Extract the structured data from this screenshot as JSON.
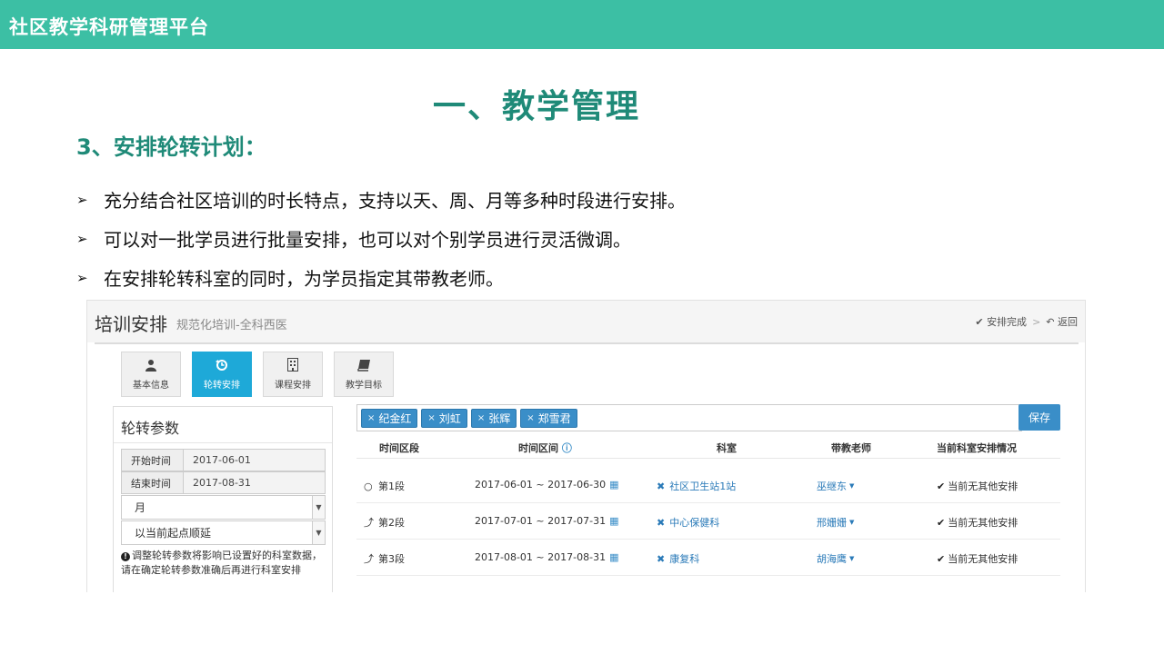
{
  "topbar": {
    "title": "社区教学科研管理平台"
  },
  "slide": {
    "title": "一、教学管理",
    "section": "3、安排轮转计划：",
    "bullets": [
      "充分结合社区培训的时长特点，支持以天、周、月等多种时段进行安排。",
      "可以对一批学员进行批量安排，也可以对个别学员进行灵活微调。",
      "在安排轮转科室的同时，为学员指定其带教老师。"
    ]
  },
  "app": {
    "title": "培训安排",
    "subtitle": "规范化培训-全科西医",
    "actions": {
      "complete": "安排完成",
      "back": "返回"
    },
    "tabs": [
      {
        "label": "基本信息",
        "icon": "user-icon"
      },
      {
        "label": "轮转安排",
        "icon": "rotate-icon"
      },
      {
        "label": "课程安排",
        "icon": "building-icon"
      },
      {
        "label": "教学目标",
        "icon": "book-icon"
      }
    ],
    "params": {
      "title": "轮转参数",
      "start_label": "开始时间",
      "start_value": "2017-06-01",
      "end_label": "结束时间",
      "end_value": "2017-08-31",
      "period_select": "月",
      "mode_select": "以当前起点顺延",
      "note": "调整轮转参数将影响已设置好的科室数据，请在确定轮转参数准确后再进行科室安排"
    },
    "students": [
      "纪金红",
      "刘虹",
      "张辉",
      "郑雪君"
    ],
    "save_label": "保存",
    "table": {
      "headers": [
        "时间区段",
        "时间区间",
        "科室",
        "带教老师",
        "当前科室安排情况"
      ],
      "rows": [
        {
          "segment": "第1段",
          "range": "2017-06-01 ~ 2017-06-30",
          "dept": "社区卫生站1站",
          "teacher": "巫继东",
          "status": "当前无其他安排"
        },
        {
          "segment": "第2段",
          "range": "2017-07-01 ~ 2017-07-31",
          "dept": "中心保健科",
          "teacher": "邢姗姗",
          "status": "当前无其他安排"
        },
        {
          "segment": "第3段",
          "range": "2017-08-01 ~ 2017-08-31",
          "dept": "康复科",
          "teacher": "胡海鹰",
          "status": "当前无其他安排"
        }
      ]
    }
  },
  "colors": {
    "brand": "#3cbfa4",
    "heading": "#1f8a78",
    "accent": "#3a8ec8",
    "active_tab": "#1ea9d8"
  }
}
